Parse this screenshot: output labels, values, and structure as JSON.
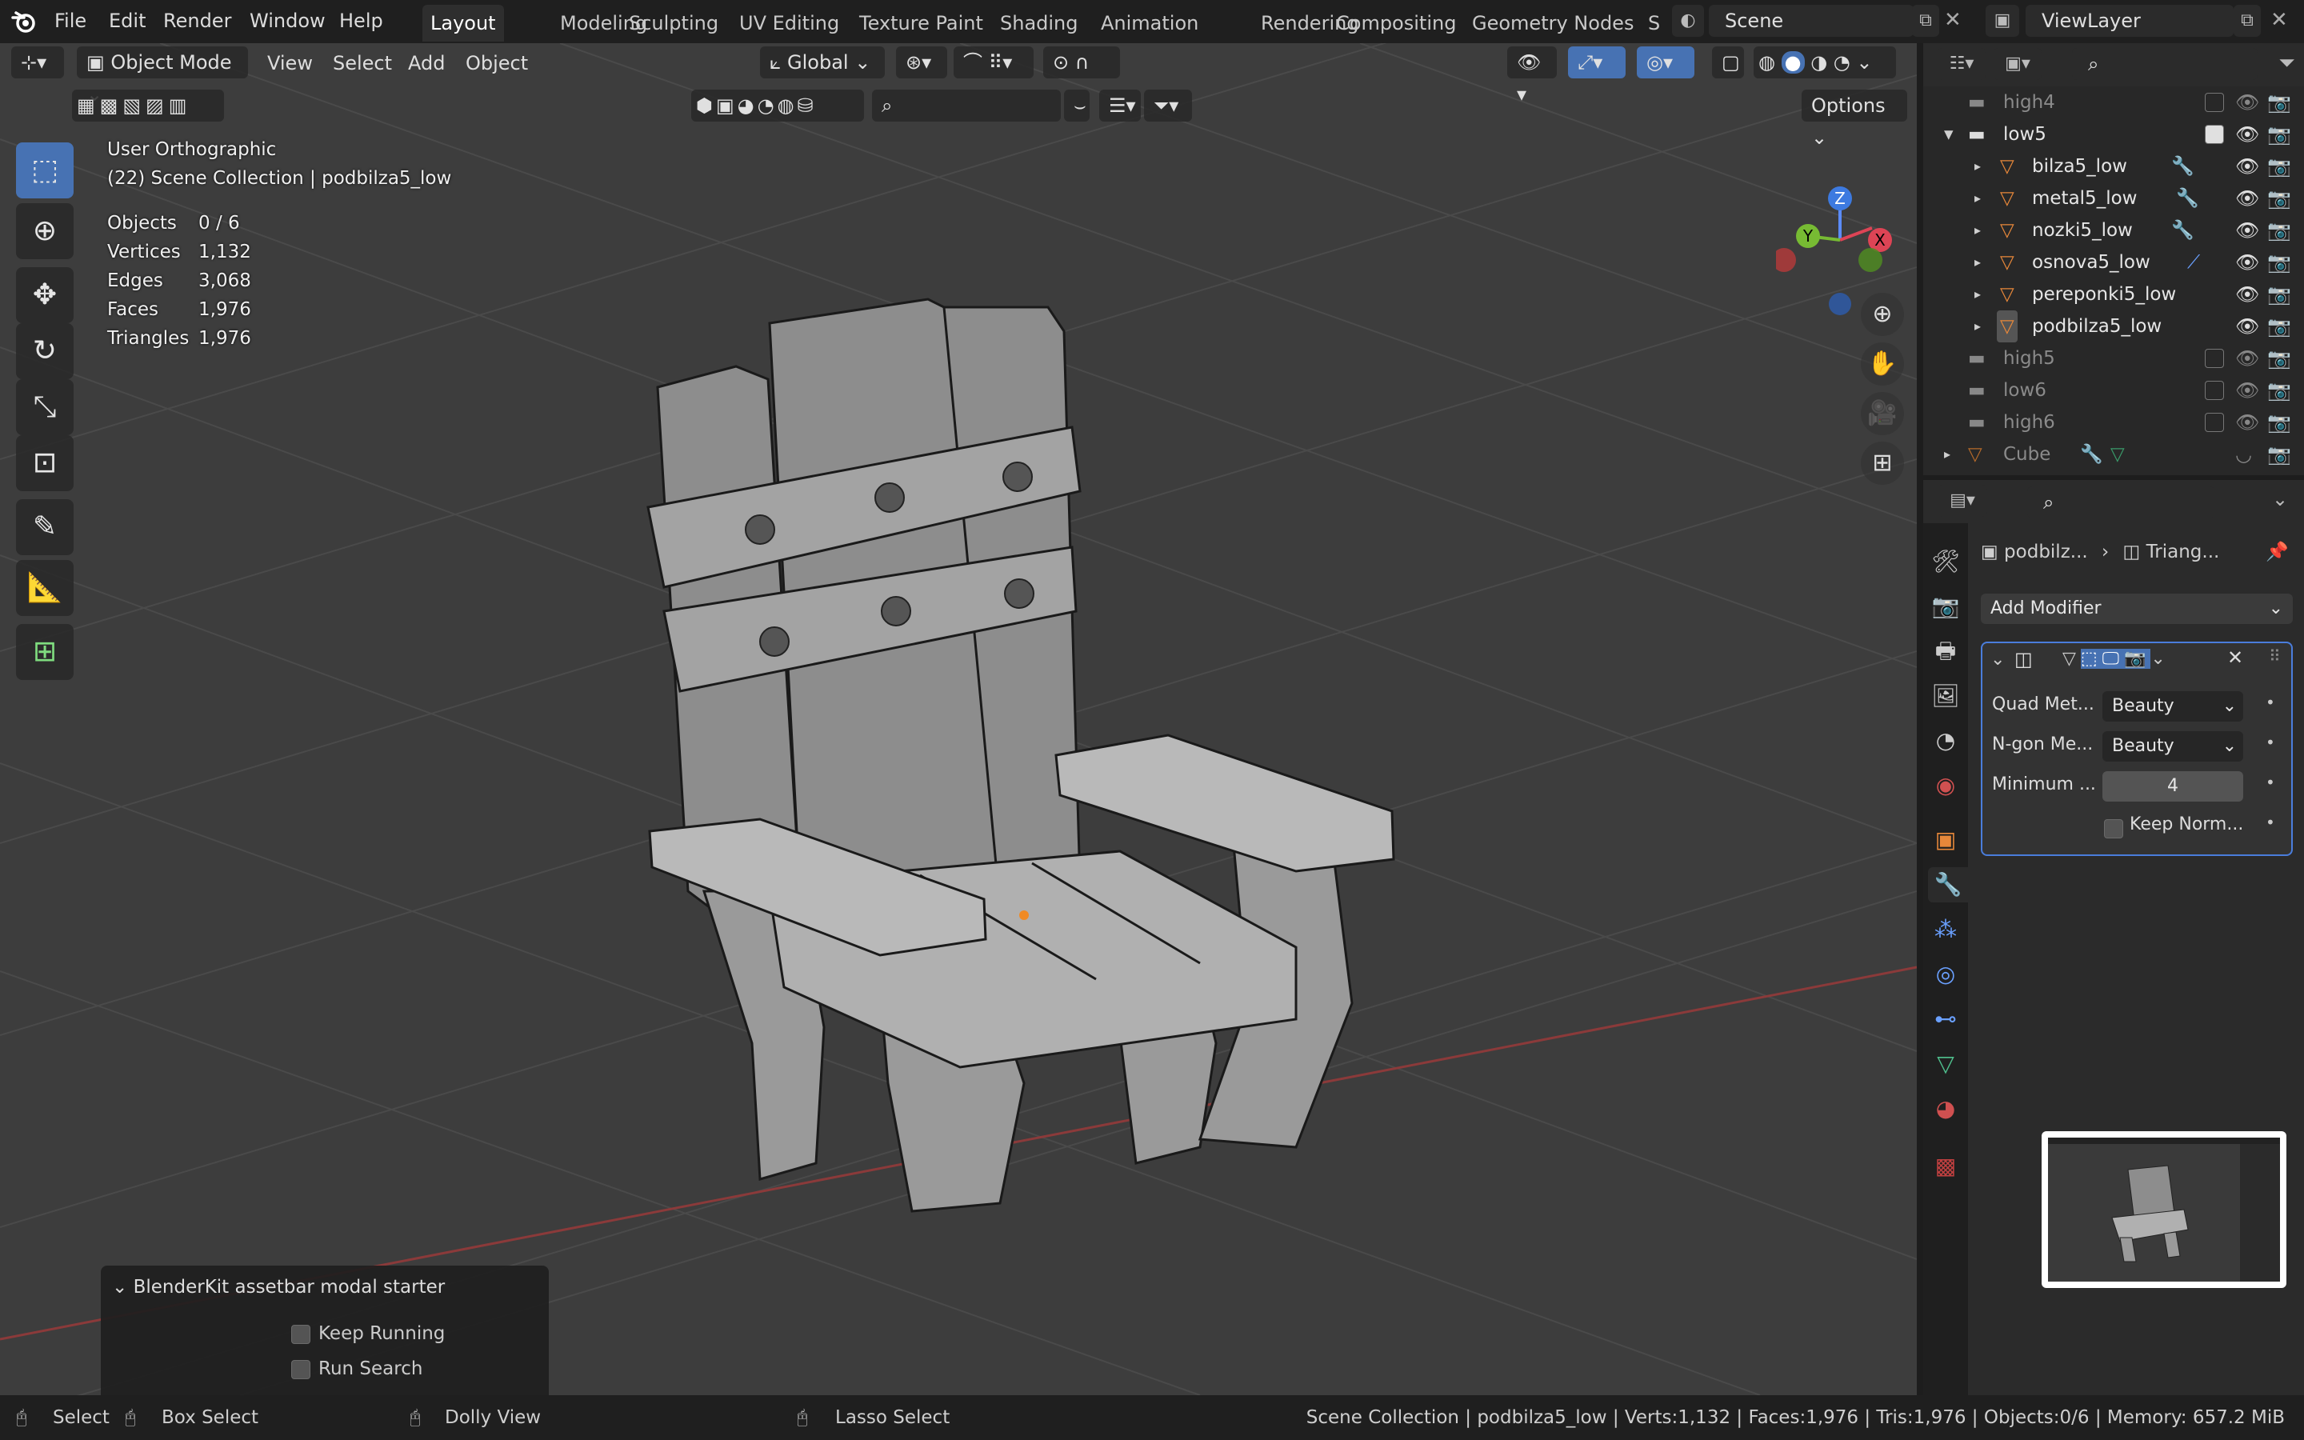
{
  "app": {
    "logo": "blender-logo-icon"
  },
  "menu": [
    "File",
    "Edit",
    "Render",
    "Window",
    "Help"
  ],
  "workspaces": [
    "Layout",
    "Modeling",
    "Sculpting",
    "UV Editing",
    "Texture Paint",
    "Shading",
    "Animation",
    "Rendering",
    "Compositing",
    "Geometry Nodes",
    "S"
  ],
  "scene": {
    "name": "Scene",
    "view_layer": "ViewLayer"
  },
  "viewport_header": {
    "mode": "Object Mode",
    "menus": [
      "View",
      "Select",
      "Add",
      "Object"
    ],
    "orientation": "Global",
    "options": "Options"
  },
  "overlay": {
    "view_name": "User Orthographic",
    "collection": "(22) Scene Collection | podbilza5_low",
    "stats": [
      {
        "label": "Objects",
        "value": "0 / 6"
      },
      {
        "label": "Vertices",
        "value": "1,132"
      },
      {
        "label": "Edges",
        "value": "3,068"
      },
      {
        "label": "Faces",
        "value": "1,976"
      },
      {
        "label": "Triangles",
        "value": "1,976"
      }
    ]
  },
  "gizmo": {
    "z": "Z",
    "y": "Y",
    "x": "X"
  },
  "outliner": {
    "rows": [
      {
        "name": "high4",
        "type": "collection",
        "dim": true
      },
      {
        "name": "low5",
        "type": "collection",
        "dim": false
      },
      {
        "name": "bilza5_low",
        "type": "mesh",
        "dim": false
      },
      {
        "name": "metal5_low",
        "type": "mesh",
        "dim": false
      },
      {
        "name": "nozki5_low",
        "type": "mesh",
        "dim": false
      },
      {
        "name": "osnova5_low",
        "type": "mesh",
        "dim": false
      },
      {
        "name": "pereponki5_low",
        "type": "mesh",
        "dim": false
      },
      {
        "name": "podbilza5_low",
        "type": "mesh",
        "dim": false
      },
      {
        "name": "high5",
        "type": "collection",
        "dim": true
      },
      {
        "name": "low6",
        "type": "collection",
        "dim": true
      },
      {
        "name": "high6",
        "type": "collection",
        "dim": true
      },
      {
        "name": "Cube",
        "type": "mesh",
        "dim": true
      }
    ]
  },
  "properties": {
    "breadcrumb_object": "podbilz...",
    "breadcrumb_modifier": "Triang...",
    "add_modifier": "Add Modifier",
    "fields": [
      {
        "label": "Quad Met...",
        "value": "Beauty"
      },
      {
        "label": "N-gon Me...",
        "value": "Beauty"
      },
      {
        "label": "Minimum ...",
        "value": "4"
      }
    ],
    "keep_normals": "Keep Norm..."
  },
  "blenderkit": {
    "title": "BlenderKit assetbar modal starter",
    "options": [
      "Keep Running",
      "Run Search"
    ]
  },
  "statusbar": {
    "left": [
      "Select",
      "Box Select",
      "Dolly View",
      "Lasso Select"
    ],
    "right": "Scene Collection | podbilza5_low | Verts:1,132 | Faces:1,976 | Tris:1,976 | Objects:0/6 | Memory: 657.2 MiB"
  },
  "colors": {
    "accent": "#4772b3",
    "mesh_icon": "#e8883a",
    "modifier_icon": "#6aa0ff",
    "x_axis": "#c0392b"
  }
}
